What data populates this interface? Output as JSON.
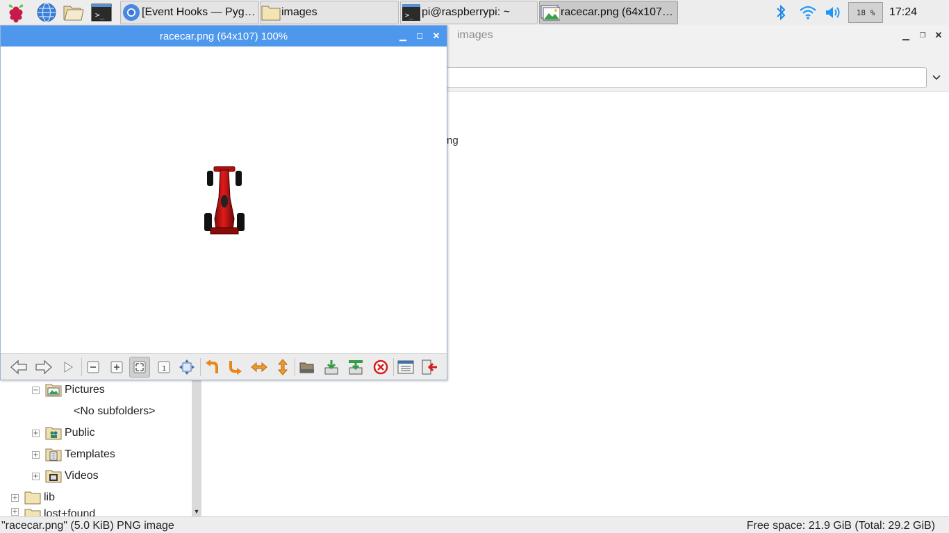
{
  "taskbar": {
    "launchers": [
      {
        "name": "raspberry-menu-icon"
      },
      {
        "name": "web-browser-icon"
      },
      {
        "name": "file-manager-icon"
      },
      {
        "name": "terminal-icon"
      }
    ],
    "tasks": [
      {
        "label": "[Event Hooks — Pyga…",
        "icon": "chromium-icon",
        "active": false
      },
      {
        "label": "images",
        "icon": "folder-icon",
        "active": false
      },
      {
        "label": "pi@raspberrypi: ~",
        "icon": "terminal-icon",
        "active": false
      },
      {
        "label": "racecar.png (64x107) …",
        "icon": "image-viewer-icon",
        "active": true
      }
    ],
    "cpu_usage": "18 %",
    "clock": "17:24",
    "colors": {
      "bluetooth": "#1e88e5",
      "wifi": "#2196f3",
      "volume": "#2196f3"
    }
  },
  "file_manager": {
    "title": "images",
    "file_peek": "ng",
    "sidebar": {
      "items": [
        {
          "label": "Pictures",
          "expander": "−",
          "icon": "pictures-folder-icon"
        },
        {
          "label": "<No subfolders>",
          "expander": "",
          "icon": ""
        },
        {
          "label": "Public",
          "expander": "+",
          "icon": "public-folder-icon"
        },
        {
          "label": "Templates",
          "expander": "+",
          "icon": "templates-folder-icon"
        },
        {
          "label": "Videos",
          "expander": "+",
          "icon": "videos-folder-icon"
        },
        {
          "label": "lib",
          "expander": "+",
          "icon": "folder-icon"
        },
        {
          "label": "lost+found",
          "expander": "+",
          "icon": "folder-icon"
        }
      ]
    },
    "status_left": "\"racecar.png\" (5.0 KiB) PNG image",
    "status_right": "Free space: 21.9 GiB (Total: 29.2 GiB)"
  },
  "viewer": {
    "title": "racecar.png (64x107) 100%",
    "titlebar_color": "#4d97ed",
    "toolbar": [
      {
        "name": "previous-button",
        "icon": "arrow-left-icon"
      },
      {
        "name": "next-button",
        "icon": "arrow-right-icon"
      },
      {
        "name": "slideshow-button",
        "icon": "play-icon"
      },
      {
        "name": "zoom-out-button",
        "icon": "zoom-out-icon"
      },
      {
        "name": "zoom-in-button",
        "icon": "zoom-in-icon"
      },
      {
        "name": "fit-window-button",
        "icon": "fit-window-icon",
        "pressed": true
      },
      {
        "name": "original-size-button",
        "icon": "original-size-icon"
      },
      {
        "name": "fullscreen-button",
        "icon": "fullscreen-icon"
      },
      {
        "name": "rotate-left-button",
        "icon": "rotate-left-icon"
      },
      {
        "name": "rotate-right-button",
        "icon": "rotate-right-icon"
      },
      {
        "name": "flip-horizontal-button",
        "icon": "flip-horizontal-icon"
      },
      {
        "name": "flip-vertical-button",
        "icon": "flip-vertical-icon"
      },
      {
        "name": "open-file-button",
        "icon": "open-file-icon"
      },
      {
        "name": "save-file-button",
        "icon": "save-file-icon"
      },
      {
        "name": "save-as-button",
        "icon": "save-as-icon"
      },
      {
        "name": "delete-file-button",
        "icon": "delete-icon"
      },
      {
        "name": "preferences-button",
        "icon": "preferences-icon"
      },
      {
        "name": "quit-button",
        "icon": "quit-icon"
      }
    ]
  }
}
